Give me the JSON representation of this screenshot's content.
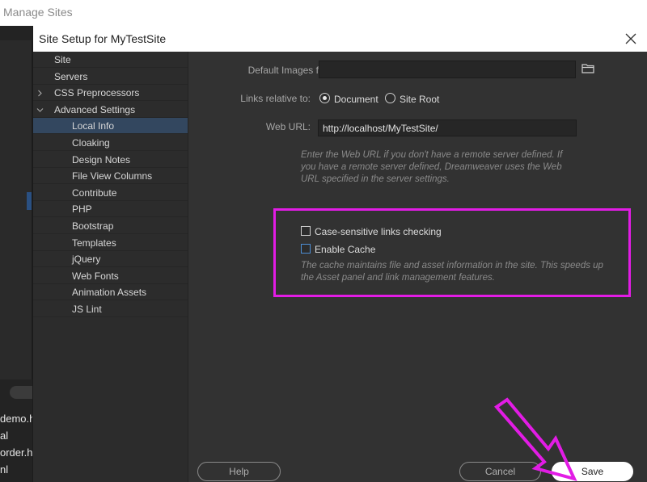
{
  "background_window": {
    "title": "Manage Sites",
    "files": [
      "demo.h",
      "al",
      "order.ht",
      "nl"
    ]
  },
  "dialog": {
    "title": "Site Setup for MyTestSite",
    "close_icon": "close-icon"
  },
  "sidebar": {
    "items": [
      {
        "label": "Site",
        "indent": 0,
        "expandable": false,
        "selected": false
      },
      {
        "label": "Servers",
        "indent": 0,
        "expandable": false,
        "selected": false
      },
      {
        "label": "CSS Preprocessors",
        "indent": 0,
        "expandable": true,
        "expanded": false,
        "selected": false
      },
      {
        "label": "Advanced Settings",
        "indent": 0,
        "expandable": true,
        "expanded": true,
        "selected": false
      },
      {
        "label": "Local Info",
        "indent": 1,
        "selected": true
      },
      {
        "label": "Cloaking",
        "indent": 1,
        "selected": false
      },
      {
        "label": "Design Notes",
        "indent": 1,
        "selected": false
      },
      {
        "label": "File View Columns",
        "indent": 1,
        "selected": false
      },
      {
        "label": "Contribute",
        "indent": 1,
        "selected": false
      },
      {
        "label": "PHP",
        "indent": 1,
        "selected": false
      },
      {
        "label": "Bootstrap",
        "indent": 1,
        "selected": false
      },
      {
        "label": "Templates",
        "indent": 1,
        "selected": false
      },
      {
        "label": "jQuery",
        "indent": 1,
        "selected": false
      },
      {
        "label": "Web Fonts",
        "indent": 1,
        "selected": false
      },
      {
        "label": "Animation Assets",
        "indent": 1,
        "selected": false
      },
      {
        "label": "JS Lint",
        "indent": 1,
        "selected": false
      }
    ]
  },
  "form": {
    "default_images_label": "Default Images folder:",
    "default_images_value": "",
    "links_relative_label": "Links relative to:",
    "links_options": [
      {
        "label": "Document",
        "selected": true
      },
      {
        "label": "Site Root",
        "selected": false
      }
    ],
    "web_url_label": "Web URL:",
    "web_url_value": "http://localhost/MyTestSite/",
    "web_url_hint_lines": [
      "Enter the Web URL if you don't have a remote server defined. If",
      "you have a remote server defined, Dreamweaver uses the Web",
      "URL specified in the server settings."
    ],
    "case_sensitive_label": "Case-sensitive links checking",
    "case_sensitive_checked": false,
    "enable_cache_label": "Enable Cache",
    "enable_cache_checked": false,
    "cache_hint_lines": [
      "The cache maintains file and asset information in the site. This speeds up",
      "the Asset panel and link management features."
    ]
  },
  "buttons": {
    "help": "Help",
    "cancel": "Cancel",
    "save": "Save"
  },
  "colors": {
    "highlight": "#e21ce5",
    "selection": "#33475f"
  }
}
